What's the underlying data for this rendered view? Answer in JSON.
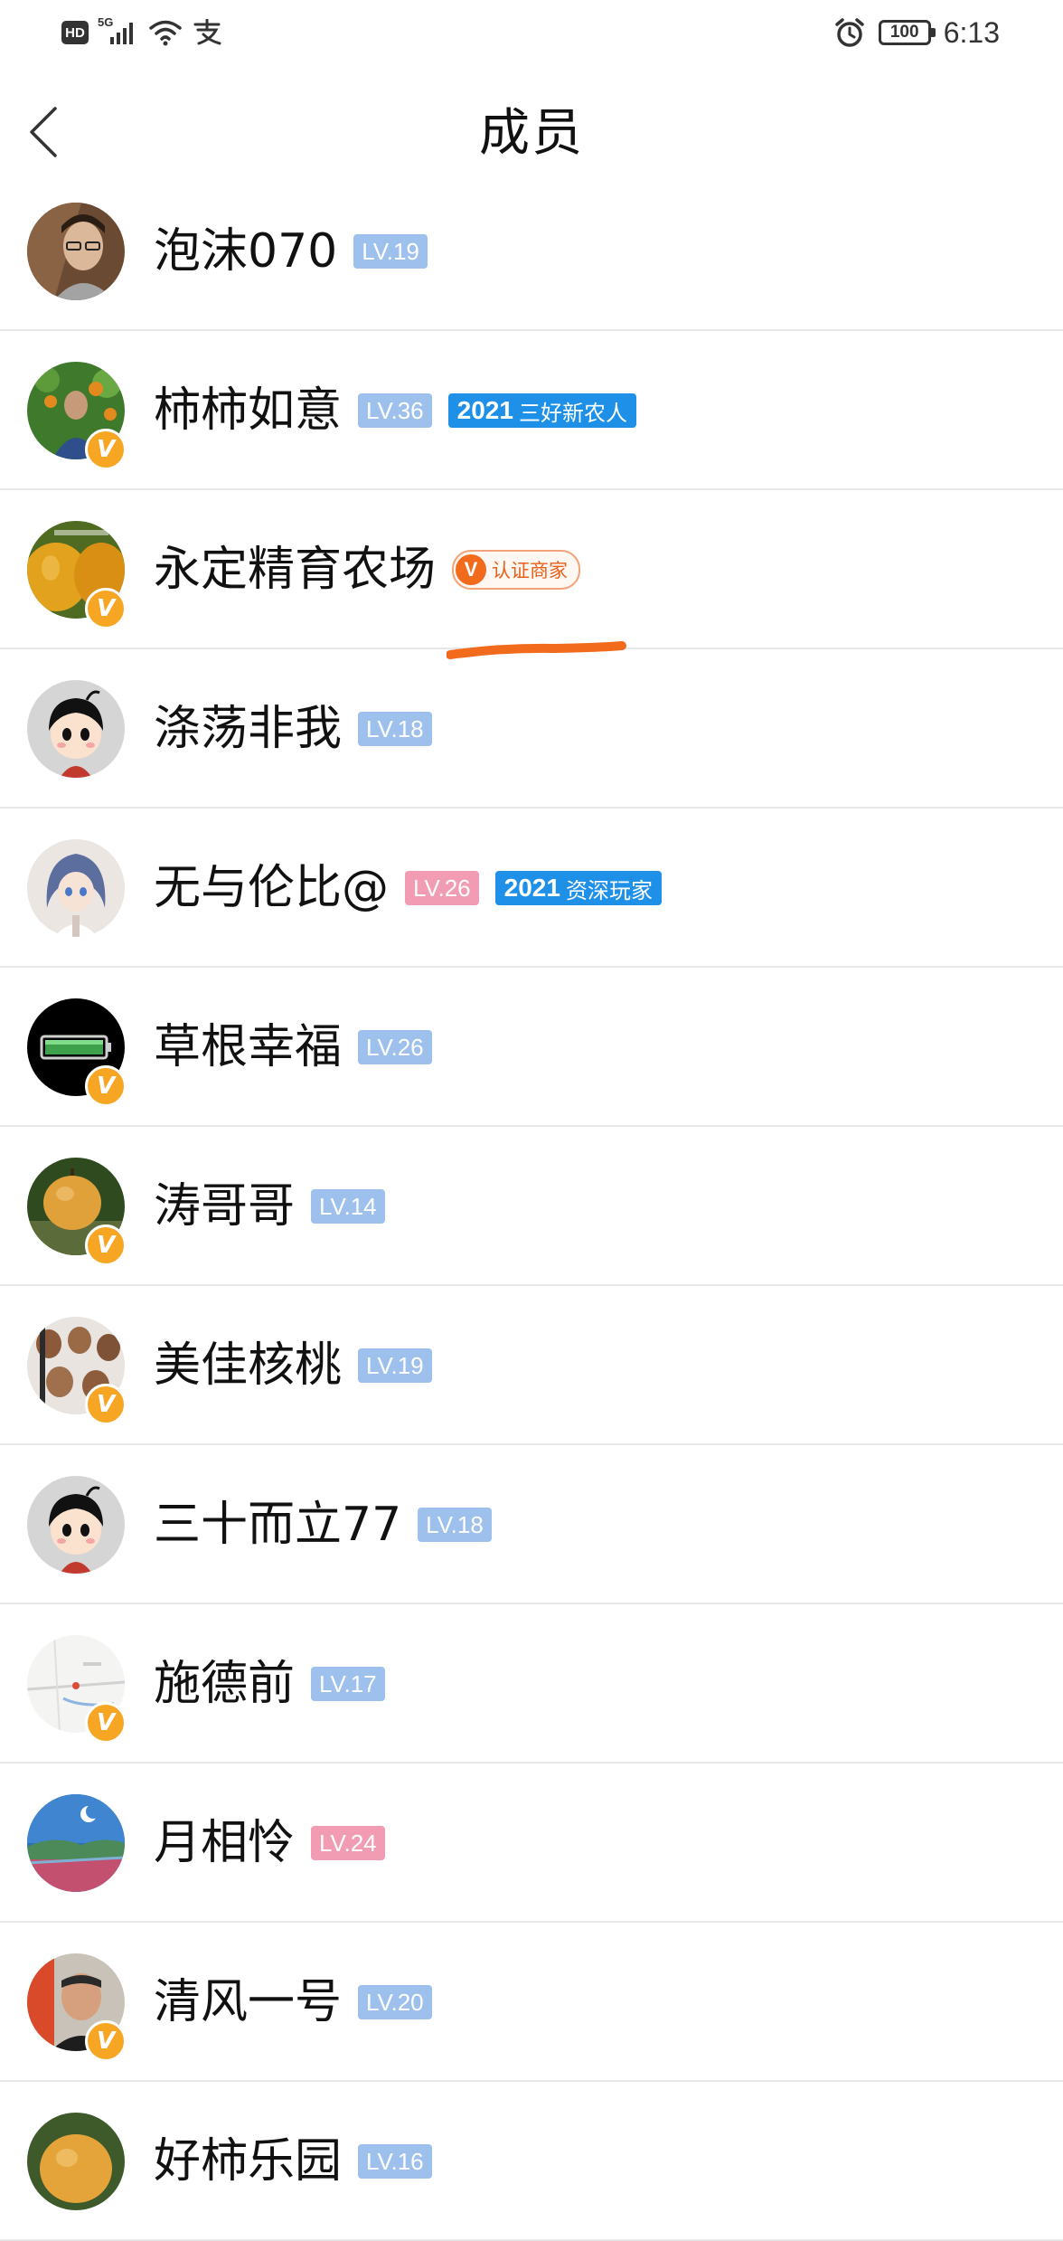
{
  "status_bar": {
    "hd": "HD",
    "network": "5G",
    "battery": "100",
    "time": "6:13",
    "icons": [
      "hd-icon",
      "signal-icon",
      "wifi-icon",
      "alipay-icon",
      "alarm-icon",
      "battery-icon"
    ]
  },
  "nav": {
    "title": "成员",
    "back_icon": "chevron-left-icon"
  },
  "colors": {
    "level_blue": "#9ec0ec",
    "level_pink": "#f29cb3",
    "tag_2021": "#1e90e8",
    "verified_badge": "#f6a623",
    "merchant": "#f26a1b",
    "highlight": "#f26a1b"
  },
  "members": [
    {
      "name": "泡沫070",
      "level": "LV.19"
    },
    {
      "name": "柿柿如意",
      "level": "LV.36",
      "tag_year": "2021",
      "tag_text": "三好新农人"
    },
    {
      "name": "永定精育农场",
      "merchant_v": "V",
      "merchant_label": "认证商家"
    },
    {
      "name": "涤荡非我",
      "level": "LV.18"
    },
    {
      "name": "无与伦比@",
      "level": "LV.26",
      "tag_year": "2021",
      "tag_text": "资深玩家"
    },
    {
      "name": "草根幸福",
      "level": "LV.26"
    },
    {
      "name": "涛哥哥",
      "level": "LV.14"
    },
    {
      "name": "美佳核桃",
      "level": "LV.19"
    },
    {
      "name": "三十而立77",
      "level": "LV.18"
    },
    {
      "name": "施德前",
      "level": "LV.17"
    },
    {
      "name": "月相怜",
      "level": "LV.24"
    },
    {
      "name": "清风一号",
      "level": "LV.20"
    },
    {
      "name": "好柿乐园",
      "level": "LV.16"
    }
  ],
  "verified_mark": "V"
}
